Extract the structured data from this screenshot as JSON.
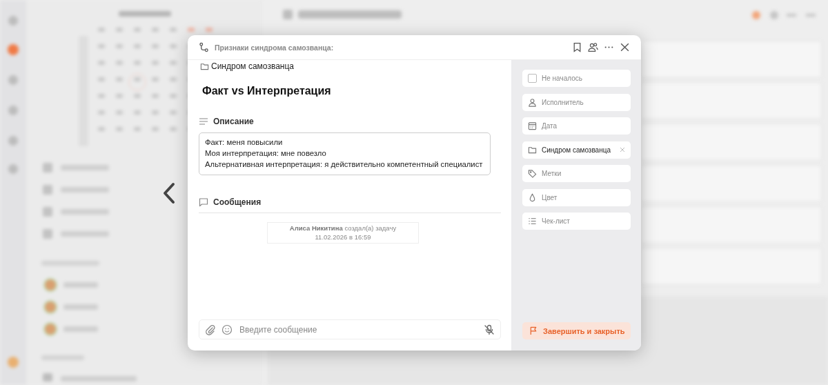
{
  "header": {
    "breadcrumb": "Признаки синдрома самозванца:"
  },
  "task": {
    "folder": "Синдром самозванца",
    "title": "Факт vs Интерпретация",
    "description_label": "Описание",
    "description": [
      "Факт: меня повысили",
      "Моя интерпретация: мне повезло",
      "Альтернативная интерпретация: я действительно компетентный специалист"
    ],
    "messages_label": "Сообщения",
    "events": [
      {
        "author": "Алиса Никитина",
        "action": "создал(а) задачу",
        "time": "11.02.2026 в 16:59"
      }
    ]
  },
  "composer": {
    "placeholder": "Введите сообщение"
  },
  "fields": [
    {
      "kind": "status",
      "label": "Не началось",
      "checked": false
    },
    {
      "kind": "assignee",
      "label": "Исполнитель"
    },
    {
      "kind": "date",
      "label": "Дата"
    },
    {
      "kind": "folder",
      "value": "Синдром самозванца"
    },
    {
      "kind": "tags",
      "label": "Метки"
    },
    {
      "kind": "color",
      "label": "Цвет"
    },
    {
      "kind": "checklist",
      "label": "Чек-лист"
    }
  ],
  "finish_button": "Завершить и закрыть"
}
